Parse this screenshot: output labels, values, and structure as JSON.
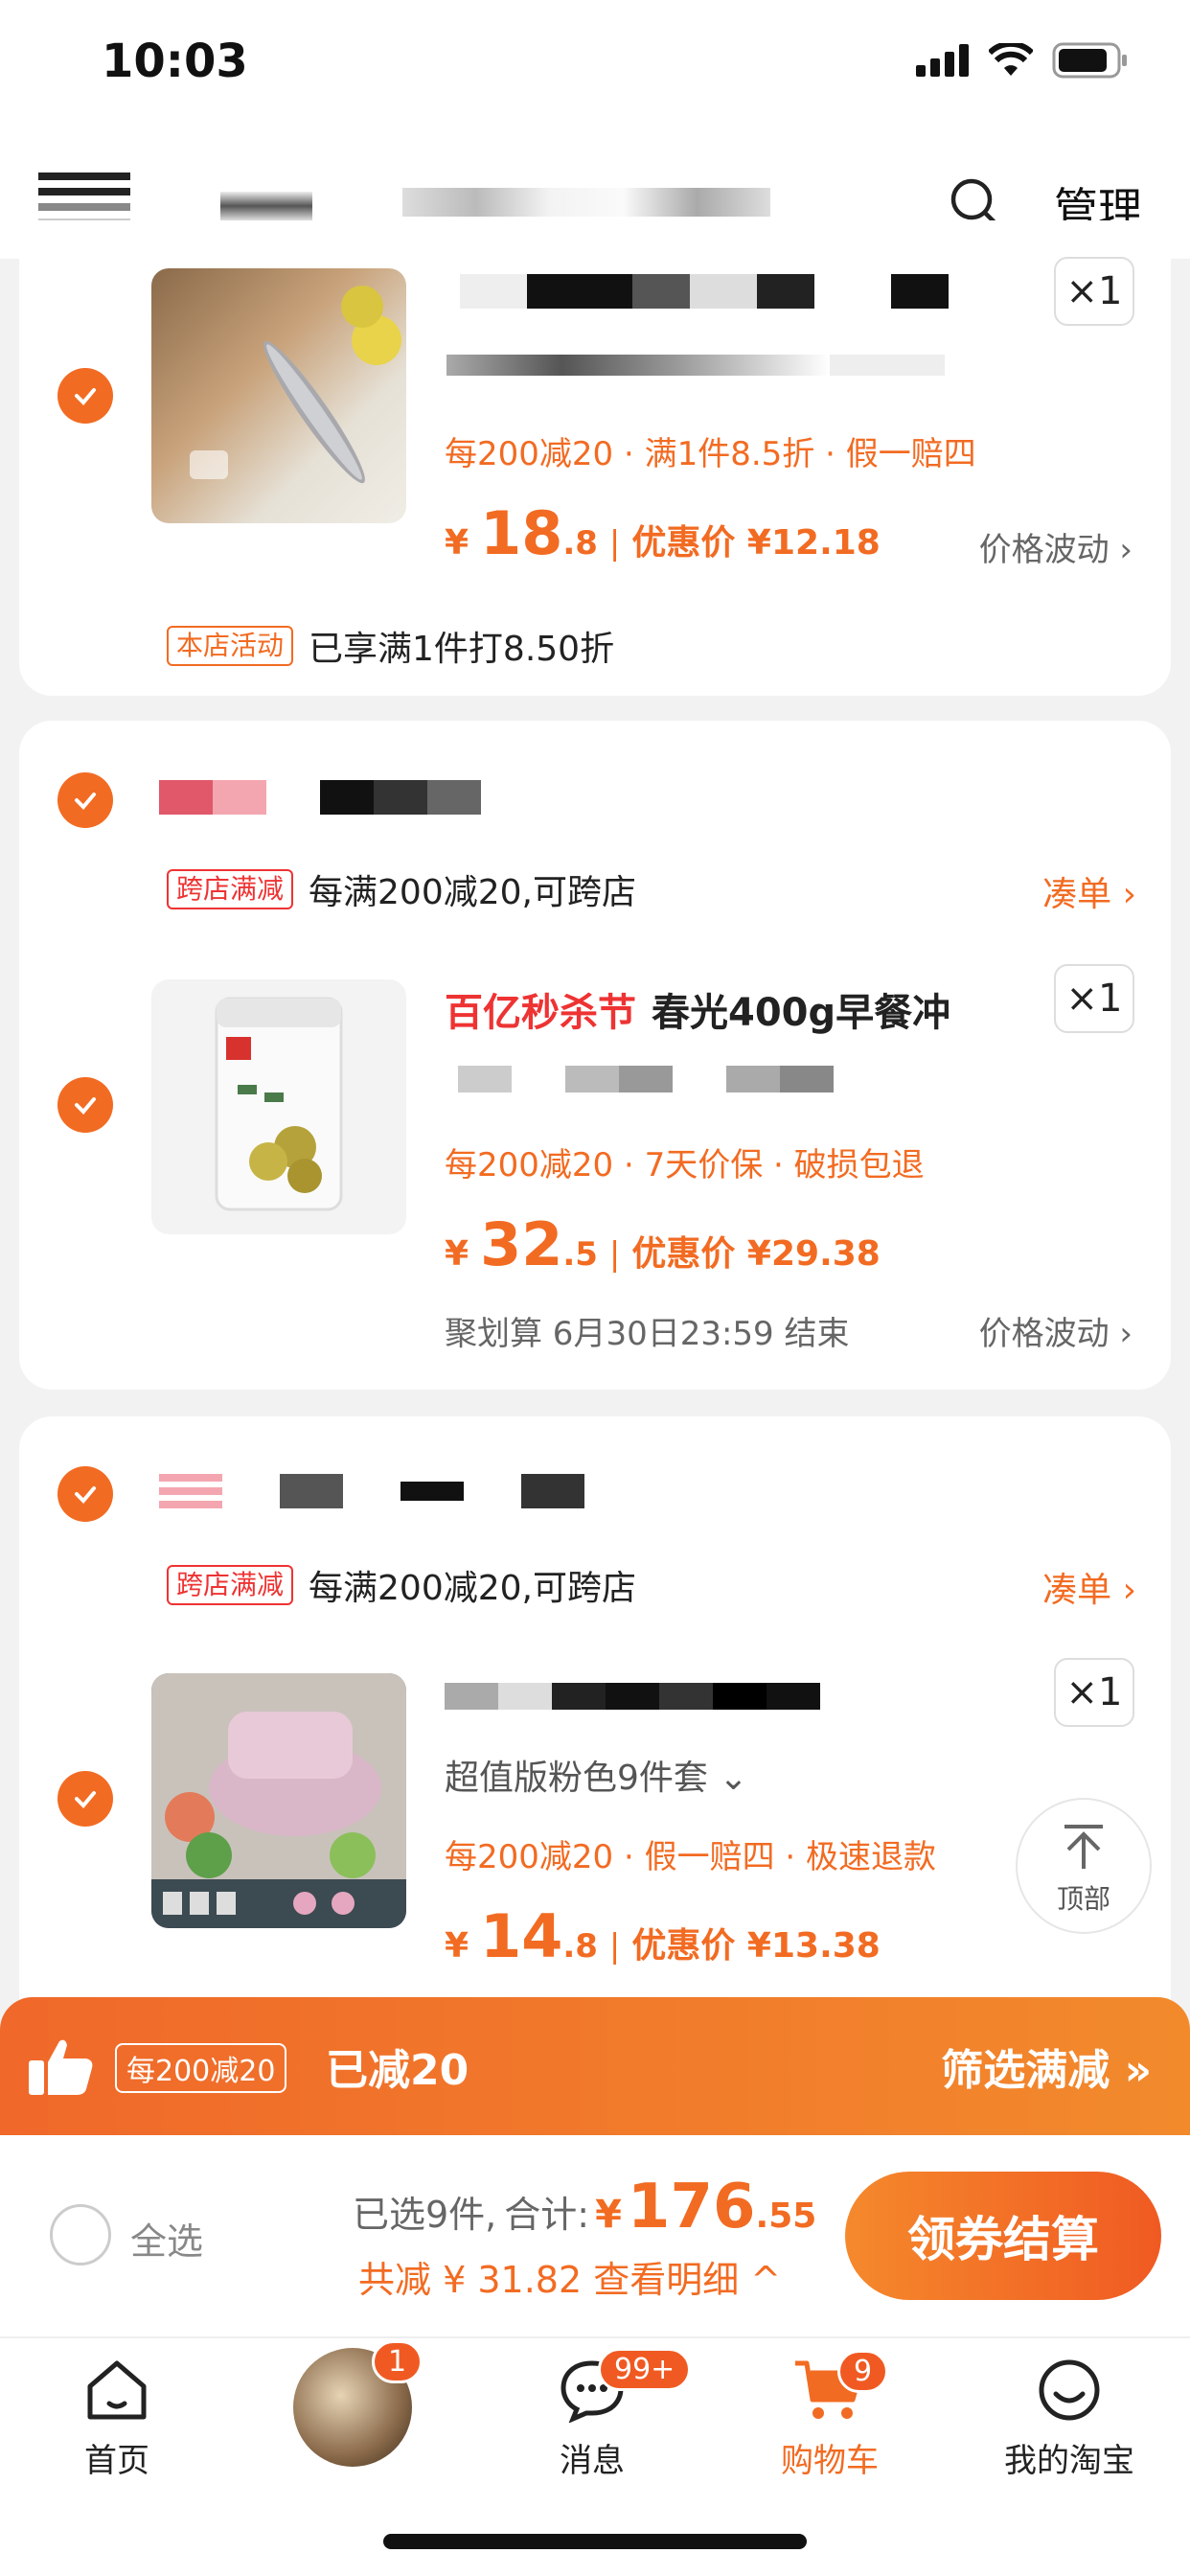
{
  "status_bar": {
    "time": "10:03"
  },
  "header": {
    "manage_label": "管理"
  },
  "items": [
    {
      "qty": "×1",
      "promo": "每200减20 · 满1件8.5折 · 假一赔四",
      "price_currency": "¥",
      "price_int": "18",
      "price_dec": ".8",
      "price_sep": "|",
      "discount_label": "优惠价 ¥12.18",
      "fluct_label": "价格波动 ›",
      "activity_tag": "本店活动",
      "activity_text": "已享满1件打8.50折"
    },
    {
      "store_tag": "跨店满减",
      "store_text": "每满200减20,可跨店",
      "coudan_label": "凑单 ›",
      "title_highlight": "百亿秒杀节",
      "title_text": "春光400g早餐冲",
      "qty": "×1",
      "promo": "每200减20 · 7天价保 · 破损包退",
      "price_currency": "¥",
      "price_int": "32",
      "price_dec": ".5",
      "price_sep": "|",
      "discount_label": "优惠价 ¥29.38",
      "footnote": "聚划算 6月30日23:59 结束",
      "fluct_label": "价格波动 ›"
    },
    {
      "store_tag": "跨店满减",
      "store_text": "每满200减20,可跨店",
      "coudan_label": "凑单 ›",
      "sku": "超值版粉色9件套 ⌄",
      "qty": "×1",
      "promo": "每200减20 · 假一赔四 · 极速退款",
      "price_currency": "¥",
      "price_int": "14",
      "price_dec": ".8",
      "price_sep": "|",
      "discount_label": "优惠价 ¥13.38"
    }
  ],
  "back_top": {
    "label": "顶部"
  },
  "banner": {
    "tag": "每200减20",
    "text": "已减20",
    "right": "筛选满减 »"
  },
  "checkout": {
    "select_all": "全选",
    "selected": "已选9件,",
    "total_label": "合计:",
    "total_currency": "¥",
    "total_int": "176",
    "total_dec": ".55",
    "saved": "共减 ¥ 31.82  查看明细 ^",
    "pay_button": "领券结算"
  },
  "tabbar": {
    "home": "首页",
    "avatar_badge": "1",
    "messages": "消息",
    "messages_badge": "99+",
    "cart": "购物车",
    "cart_badge": "9",
    "me": "我的淘宝"
  },
  "colors": {
    "accent": "#f26b22",
    "red": "#e33333"
  }
}
